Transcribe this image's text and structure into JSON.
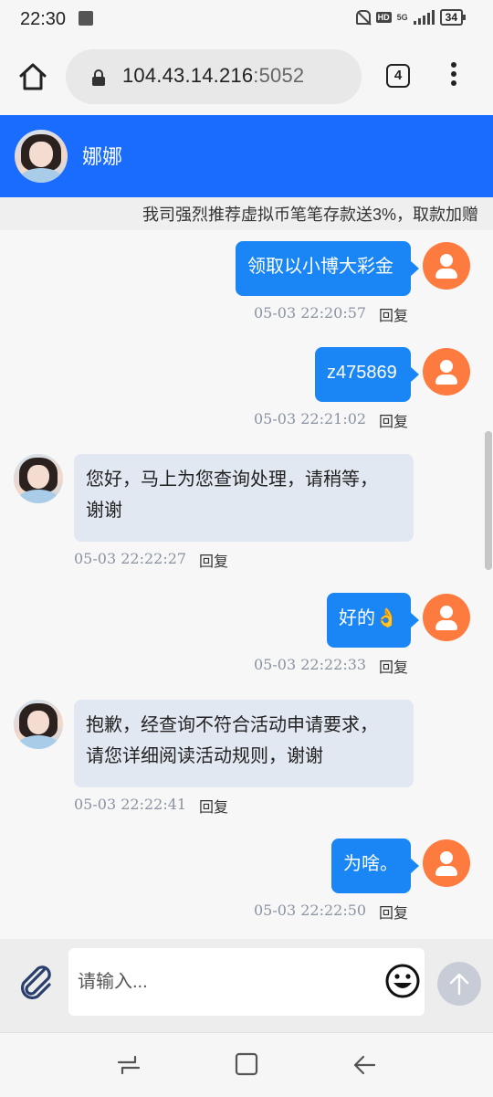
{
  "status": {
    "time": "22:30",
    "battery": "34",
    "network": "5G",
    "hd": "HD"
  },
  "browser": {
    "host": "104.43.14.216",
    "port": ":5052",
    "tab_count": "4"
  },
  "header": {
    "name": "娜娜"
  },
  "notice": {
    "text": "我司强烈推荐虚拟币笔笔存款送3%，取款加赠"
  },
  "messages": [
    {
      "dir": "out",
      "text": "领取以小博大彩金",
      "time": "05-03 22:20:57",
      "reply": "回复"
    },
    {
      "dir": "out",
      "text": "z475869",
      "time": "05-03 22:21:02",
      "reply": "回复"
    },
    {
      "dir": "in",
      "line1": "您好，马上为您查询处理，请稍等，",
      "line2": "谢谢",
      "time": "05-03 22:22:27",
      "reply": "回复"
    },
    {
      "dir": "out",
      "text": "好的👌",
      "time": "05-03 22:22:33",
      "reply": "回复"
    },
    {
      "dir": "in",
      "line1": "抱歉，经查询不符合活动申请要求，",
      "line2": "请您详细阅读活动规则，谢谢",
      "time": "05-03 22:22:41",
      "reply": "回复"
    },
    {
      "dir": "out",
      "text": "为啥。",
      "time": "05-03 22:22:50",
      "reply": "回复"
    }
  ],
  "composer": {
    "placeholder": "请输入..."
  },
  "icons": [
    "note-icon",
    "mute-icon",
    "signal-icon",
    "battery-icon",
    "home-icon",
    "lock-icon",
    "tabs-icon",
    "more-icon",
    "paperclip-icon",
    "emoji-icon",
    "send-arrow-icon",
    "recent-apps-icon",
    "home-square-icon",
    "back-icon"
  ],
  "colors": {
    "header": "#1a6cff",
    "bubble_out": "#1a86f6",
    "bubble_in": "#e2e8f1",
    "user_avatar": "#fd7b3f"
  }
}
